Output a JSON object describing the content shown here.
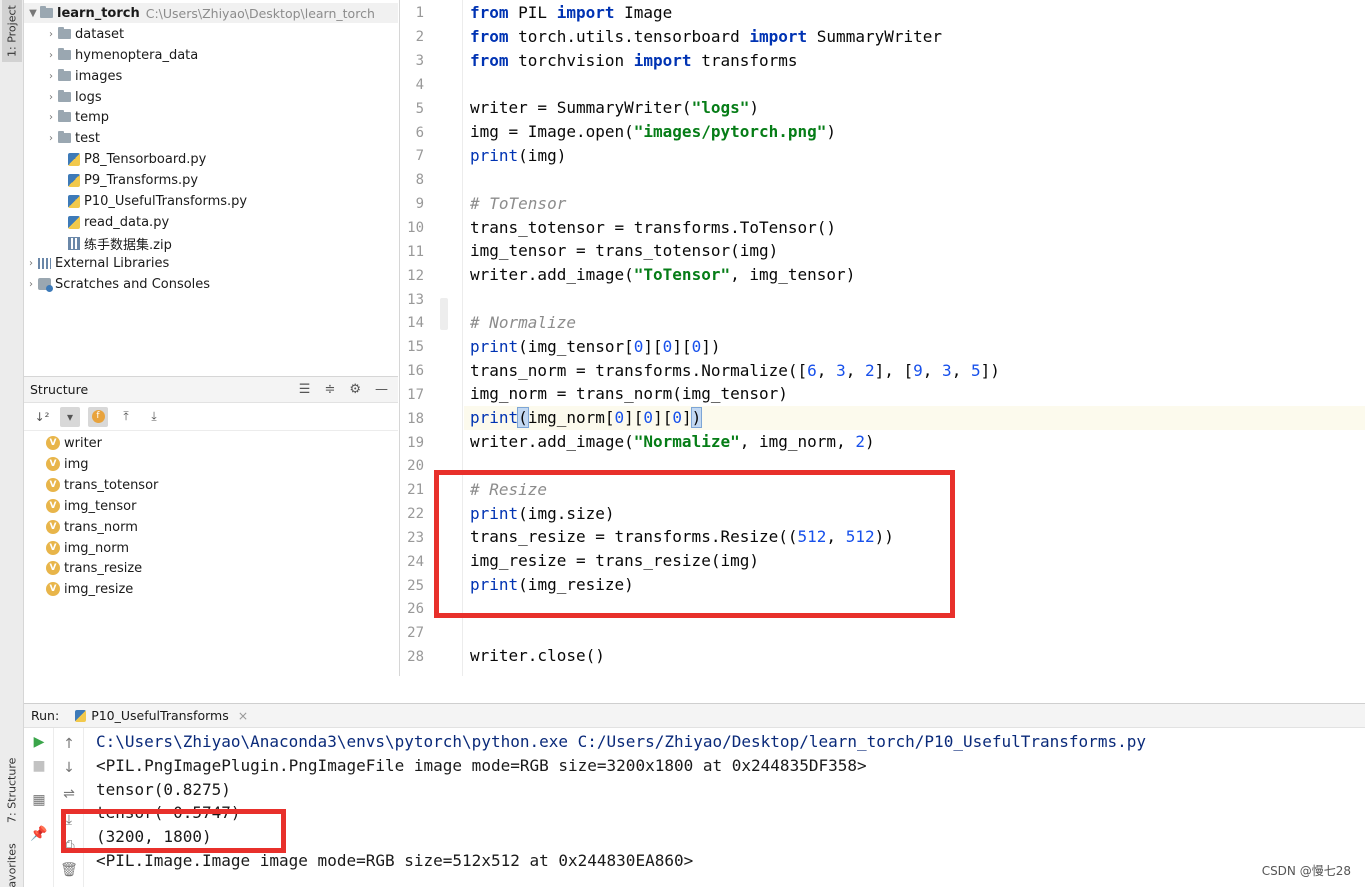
{
  "sidebar_tabs": {
    "project": "1: Project",
    "structure": "7: Structure",
    "favorites": "Favorites"
  },
  "project_tree": {
    "root_name": "learn_torch",
    "root_path": "C:\\Users\\Zhiyao\\Desktop\\learn_torch",
    "folders": [
      "dataset",
      "hymenoptera_data",
      "images",
      "logs",
      "temp",
      "test"
    ],
    "files": [
      "P8_Tensorboard.py",
      "P9_Transforms.py",
      "P10_UsefulTransforms.py",
      "read_data.py",
      "练手数据集.zip"
    ],
    "external_libraries": "External Libraries",
    "scratches": "Scratches and Consoles"
  },
  "structure": {
    "title": "Structure",
    "items": [
      "writer",
      "img",
      "trans_totensor",
      "img_tensor",
      "trans_norm",
      "img_norm",
      "trans_resize",
      "img_resize"
    ]
  },
  "editor": {
    "line_numbers": [
      "1",
      "2",
      "3",
      "4",
      "5",
      "6",
      "7",
      "8",
      "9",
      "10",
      "11",
      "12",
      "13",
      "14",
      "15",
      "16",
      "17",
      "18",
      "19",
      "20",
      "21",
      "22",
      "23",
      "24",
      "25",
      "26",
      "27",
      "28"
    ],
    "lines": {
      "l1": {
        "a": "from",
        "b": " PIL ",
        "c": "import",
        "d": " Image"
      },
      "l2": {
        "a": "from",
        "b": " torch.utils.tensorboard ",
        "c": "import",
        "d": " SummaryWriter"
      },
      "l3": {
        "a": "from",
        "b": " torchvision ",
        "c": "import",
        "d": " transforms"
      },
      "l5": {
        "a": "writer = SummaryWriter(",
        "b": "\"logs\"",
        "c": ")"
      },
      "l6": {
        "a": "img = Image.open(",
        "b": "\"images/pytorch.png\"",
        "c": ")"
      },
      "l7": {
        "a": "print",
        "b": "(img)"
      },
      "l9": "# ToTensor",
      "l10": "trans_totensor = transforms.ToTensor()",
      "l11": "img_tensor = trans_totensor(img)",
      "l12": {
        "a": "writer.add_image(",
        "b": "\"ToTensor\"",
        "c": ", img_tensor)"
      },
      "l14": "# Normalize",
      "l15": {
        "a": "print",
        "b": "(img_tensor[",
        "n1": "0",
        "c": "][",
        "n2": "0",
        "d": "][",
        "n3": "0",
        "e": "])"
      },
      "l16": {
        "a": "trans_norm = transforms.Normalize([",
        "n1": "6",
        "b": ", ",
        "n2": "3",
        "c": ", ",
        "n3": "2",
        "d": "], [",
        "n4": "9",
        "e": ", ",
        "n5": "3",
        "f": ", ",
        "n6": "5",
        "g": "])"
      },
      "l17": "img_norm = trans_norm(img_tensor)",
      "l18": {
        "a": "print",
        "b": "(",
        "c": "img_norm[",
        "n1": "0",
        "d": "][",
        "n2": "0",
        "e": "][",
        "n3": "0",
        "f": "]",
        "g": ")"
      },
      "l19": {
        "a": "writer.add_image(",
        "b": "\"Normalize\"",
        "c": ", img_norm, ",
        "n1": "2",
        "d": ")"
      },
      "l21": "# Resize",
      "l22": {
        "a": "print",
        "b": "(img.size)"
      },
      "l23": {
        "a": "trans_resize = transforms.Resize((",
        "n1": "512",
        "b": ", ",
        "n2": "512",
        "c": "))"
      },
      "l24": "img_resize = trans_resize(img)",
      "l25": {
        "a": "print",
        "b": "(img_resize)"
      },
      "l28": "writer.close()"
    }
  },
  "run": {
    "label": "Run:",
    "tab_name": "P10_UsefulTransforms",
    "output": [
      "C:\\Users\\Zhiyao\\Anaconda3\\envs\\pytorch\\python.exe C:/Users/Zhiyao/Desktop/learn_torch/P10_UsefulTransforms.py",
      "<PIL.PngImagePlugin.PngImageFile image mode=RGB size=3200x1800 at 0x244835DF358>",
      "tensor(0.8275)",
      "tensor(-0.5747)",
      "(3200, 1800)",
      "<PIL.Image.Image image mode=RGB size=512x512 at 0x244830EA860>"
    ]
  },
  "watermark": "CSDN @慢七28",
  "colors": {
    "highlight_box": "#e8302b",
    "keyword": "#0033b3",
    "string": "#067d17",
    "number": "#1750eb",
    "comment": "#8c8c8c"
  }
}
